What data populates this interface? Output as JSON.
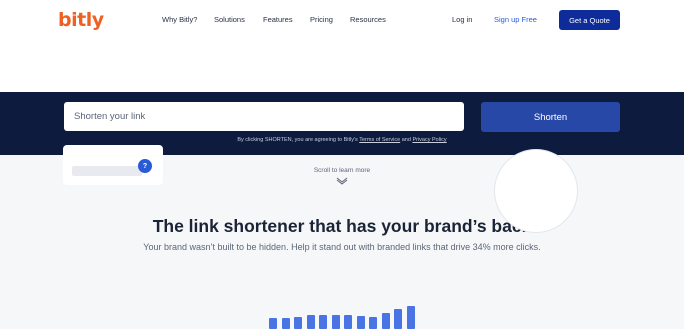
{
  "header": {
    "logo": "bitly",
    "nav": [
      "Why Bitly?",
      "Solutions",
      "Features",
      "Pricing",
      "Resources"
    ],
    "login": "Log in",
    "signup": "Sign up Free",
    "quote": "Get a Quote"
  },
  "shortener": {
    "placeholder": "Shorten your link",
    "button": "Shorten",
    "terms_prefix": "By clicking SHORTEN, you are agreeing to Bitly's",
    "terms_link": "Terms of Service",
    "terms_and": "and",
    "privacy_link": "Privacy Policy"
  },
  "hero": {
    "scroll": "Scroll to learn more",
    "headline": "The link shortener that has your brand’s back",
    "subline": "Your brand wasn’t built to be hidden. Help it stand out with branded links that drive 34% more clicks."
  },
  "preview": {
    "badge": "?",
    "bar_levels": [
      0.45,
      0.45,
      0.5,
      0.6,
      0.6,
      0.6,
      0.6,
      0.55,
      0.5,
      0.65,
      0.85,
      0.95
    ]
  },
  "colors": {
    "brand": "#ee6123",
    "band": "#0d1b3e",
    "button": "#2848a8",
    "cta": "#0e2b9a"
  }
}
